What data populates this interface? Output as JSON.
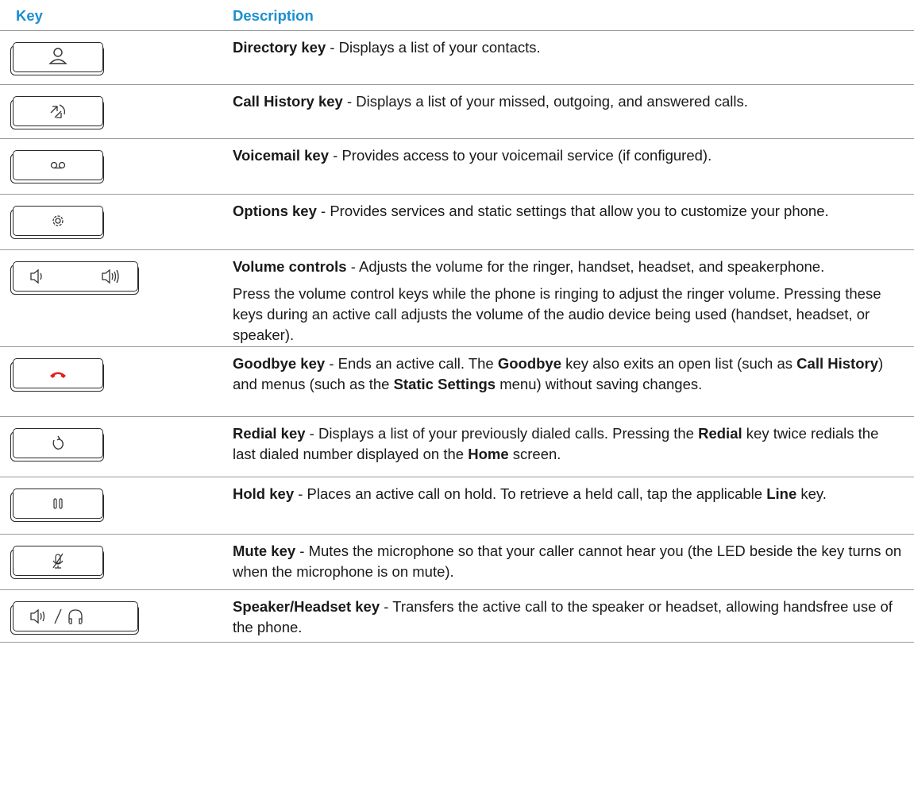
{
  "header": {
    "key": "Key",
    "description": "Description"
  },
  "rows": [
    {
      "icon": "directory-person-icon",
      "title": "Directory key",
      "paragraphs": [
        [
          {
            "t": "Directory key",
            "b": true
          },
          {
            "t": " - Displays a list of your contacts."
          }
        ]
      ]
    },
    {
      "icon": "call-history-arrows-icon",
      "title": "Call History key",
      "paragraphs": [
        [
          {
            "t": "Call History key",
            "b": true
          },
          {
            "t": " - Displays a list of your missed, outgoing, and answered calls."
          }
        ]
      ]
    },
    {
      "icon": "voicemail-icon",
      "title": "Voicemail key",
      "paragraphs": [
        [
          {
            "t": "Voicemail key",
            "b": true
          },
          {
            "t": " - Provides access to your voicemail service (if configured)."
          }
        ]
      ]
    },
    {
      "icon": "gear-icon",
      "title": "Options key",
      "paragraphs": [
        [
          {
            "t": "Options key",
            "b": true
          },
          {
            "t": " - Provides services and static settings that allow you to customize your phone."
          }
        ]
      ]
    },
    {
      "icon": "volume-icon",
      "title": "Volume controls",
      "paragraphs": [
        [
          {
            "t": "Volume controls",
            "b": true
          },
          {
            "t": " - Adjusts the volume for the ringer, handset, headset, and speakerphone."
          }
        ],
        [
          {
            "t": "Press the volume control keys while the phone is ringing to adjust the ringer volume. Pressing these keys during an active call adjusts the volume of the audio device being used (handset, headset, or speaker)."
          }
        ]
      ]
    },
    {
      "icon": "hang-up-phone-icon",
      "title": "Goodbye key",
      "paragraphs": [
        [
          {
            "t": "Goodbye key",
            "b": true
          },
          {
            "t": " - Ends an active call. The "
          },
          {
            "t": "Goodbye",
            "b": true
          },
          {
            "t": " key also exits an open list (such as "
          },
          {
            "t": "Call History",
            "b": true
          },
          {
            "t": ") and menus (such as the "
          },
          {
            "t": "Static Settings",
            "b": true
          },
          {
            "t": " menu) without saving changes."
          }
        ]
      ]
    },
    {
      "icon": "redial-icon",
      "title": "Redial key",
      "paragraphs": [
        [
          {
            "t": "Redial key",
            "b": true
          },
          {
            "t": " - Displays a list of your previously dialed calls. Pressing the "
          },
          {
            "t": "Redial",
            "b": true
          },
          {
            "t": " key twice redials the last dialed number displayed on the "
          },
          {
            "t": "Home",
            "b": true
          },
          {
            "t": " screen."
          }
        ]
      ]
    },
    {
      "icon": "hold-pause-icon",
      "title": "Hold key",
      "paragraphs": [
        [
          {
            "t": "Hold key",
            "b": true
          },
          {
            "t": " - Places an active call on hold. To retrieve a held call, tap the applicable "
          },
          {
            "t": "Line",
            "b": true
          },
          {
            "t": " key."
          }
        ]
      ]
    },
    {
      "icon": "mute-microphone-icon",
      "title": "Mute key",
      "paragraphs": [
        [
          {
            "t": "Mute key",
            "b": true
          },
          {
            "t": " - Mutes the microphone so that your caller cannot hear you (the LED beside the key turns on when the microphone is on mute)."
          }
        ]
      ]
    },
    {
      "icon": "speaker-headset-icon",
      "title": "Speaker/Headset key",
      "paragraphs": [
        [
          {
            "t": "Speaker/Headset key",
            "b": true
          },
          {
            "t": " - Transfers the active call to the speaker or headset, allowing handsfree use of the phone."
          }
        ]
      ]
    }
  ],
  "colors": {
    "header": "#1a8fd0",
    "goodbye_icon": "#e02020"
  }
}
